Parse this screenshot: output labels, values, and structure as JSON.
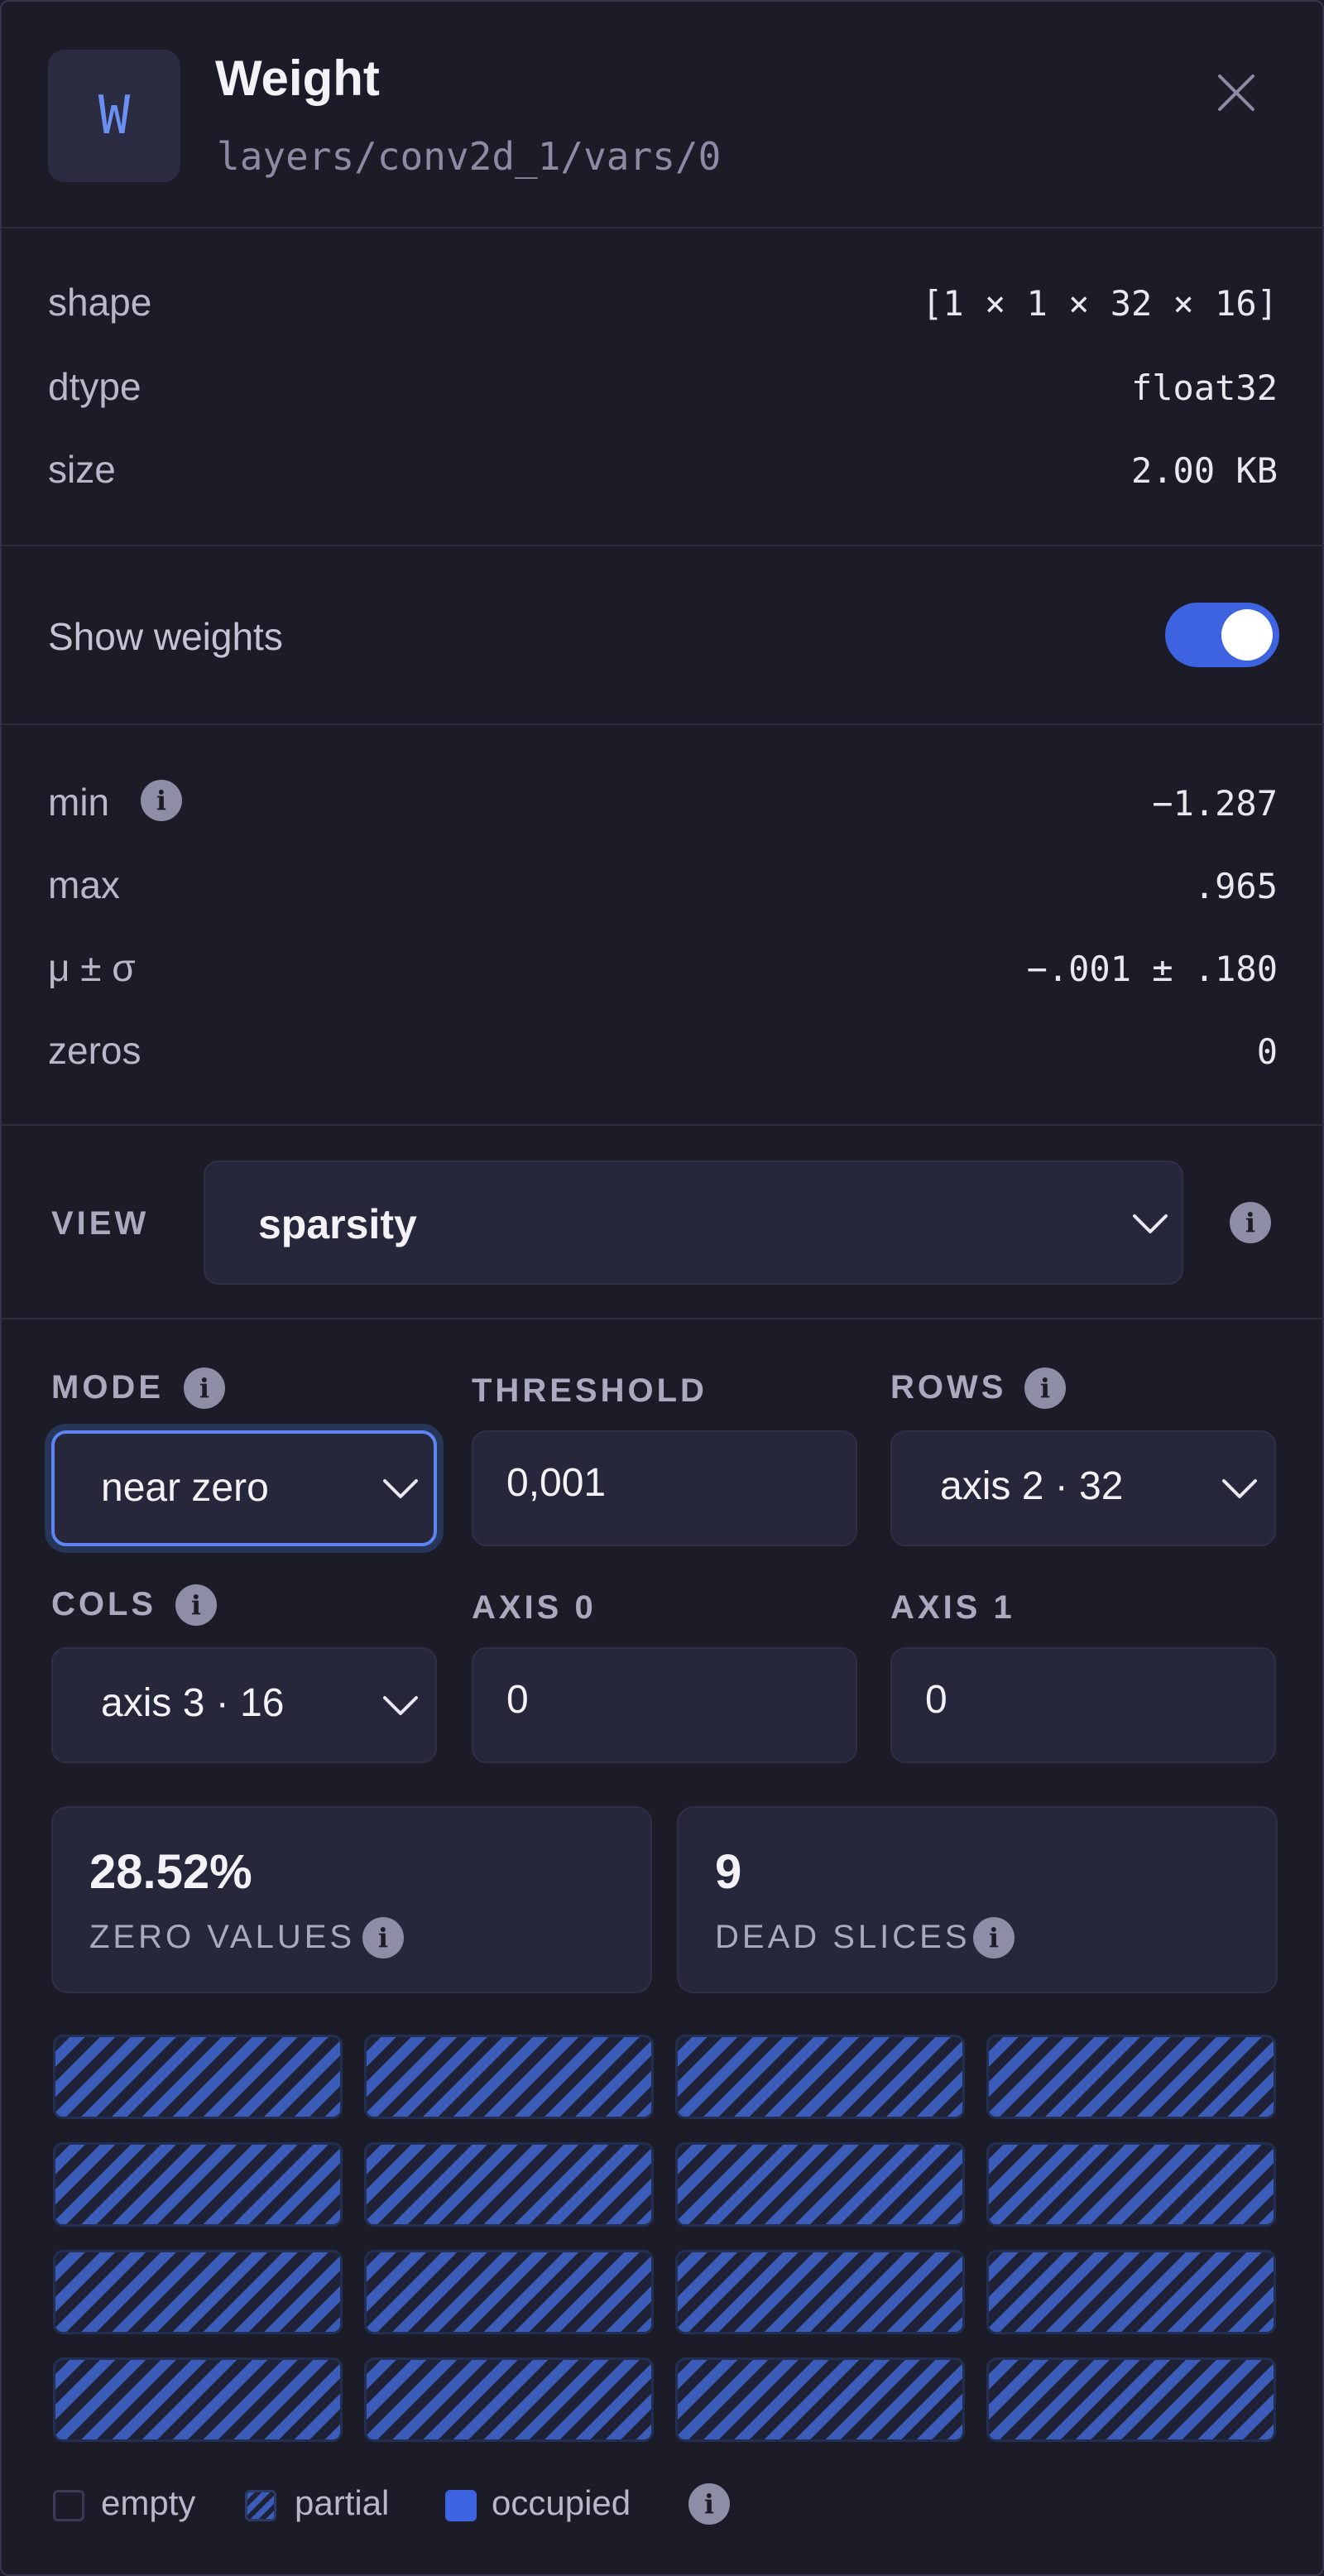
{
  "header": {
    "badge_letter": "W",
    "title": "Weight",
    "path": "layers/conv2d_1/vars/0",
    "close_icon": "close-icon"
  },
  "tensor_info": [
    {
      "label": "shape",
      "value": "[1 × 1 × 32 × 16]"
    },
    {
      "label": "dtype",
      "value": "float32"
    },
    {
      "label": "size",
      "value": "2.00 KB"
    }
  ],
  "show_weights": {
    "label": "Show weights",
    "enabled": true
  },
  "stats": [
    {
      "label": "min",
      "value": "−1.287"
    },
    {
      "label": "max",
      "value": ".965"
    },
    {
      "label": "μ ± σ",
      "value": "−.001 ± .180"
    },
    {
      "label": "zeros",
      "value": "0"
    }
  ],
  "view": {
    "label": "VIEW",
    "selected": "sparsity"
  },
  "controls": {
    "mode": {
      "label": "MODE",
      "value": "near zero"
    },
    "threshold": {
      "label": "THRESHOLD",
      "value": "0,001"
    },
    "rows": {
      "label": "ROWS",
      "value": "axis 2 · 32"
    },
    "cols": {
      "label": "COLS",
      "value": "axis 3 · 16"
    },
    "axis0": {
      "label": "AXIS 0",
      "value": "0"
    },
    "axis1": {
      "label": "AXIS 1",
      "value": "0"
    }
  },
  "summary": {
    "zero_values": {
      "value": "28.52%",
      "label": "ZERO VALUES"
    },
    "dead_slices": {
      "value": "9",
      "label": "DEAD SLICES"
    }
  },
  "grid": {
    "rows": 4,
    "cols": 4,
    "cells": [
      "partial",
      "partial",
      "partial",
      "partial",
      "partial",
      "partial",
      "partial",
      "partial",
      "partial",
      "partial",
      "partial",
      "partial",
      "partial",
      "partial",
      "partial",
      "partial"
    ]
  },
  "legend": {
    "empty": "empty",
    "partial": "partial",
    "occupied": "occupied"
  },
  "colors": {
    "background": "#1c1c29",
    "accent": "#3d63e0",
    "focus": "#5d84f0",
    "partial_stripe": "#3b5db9"
  }
}
